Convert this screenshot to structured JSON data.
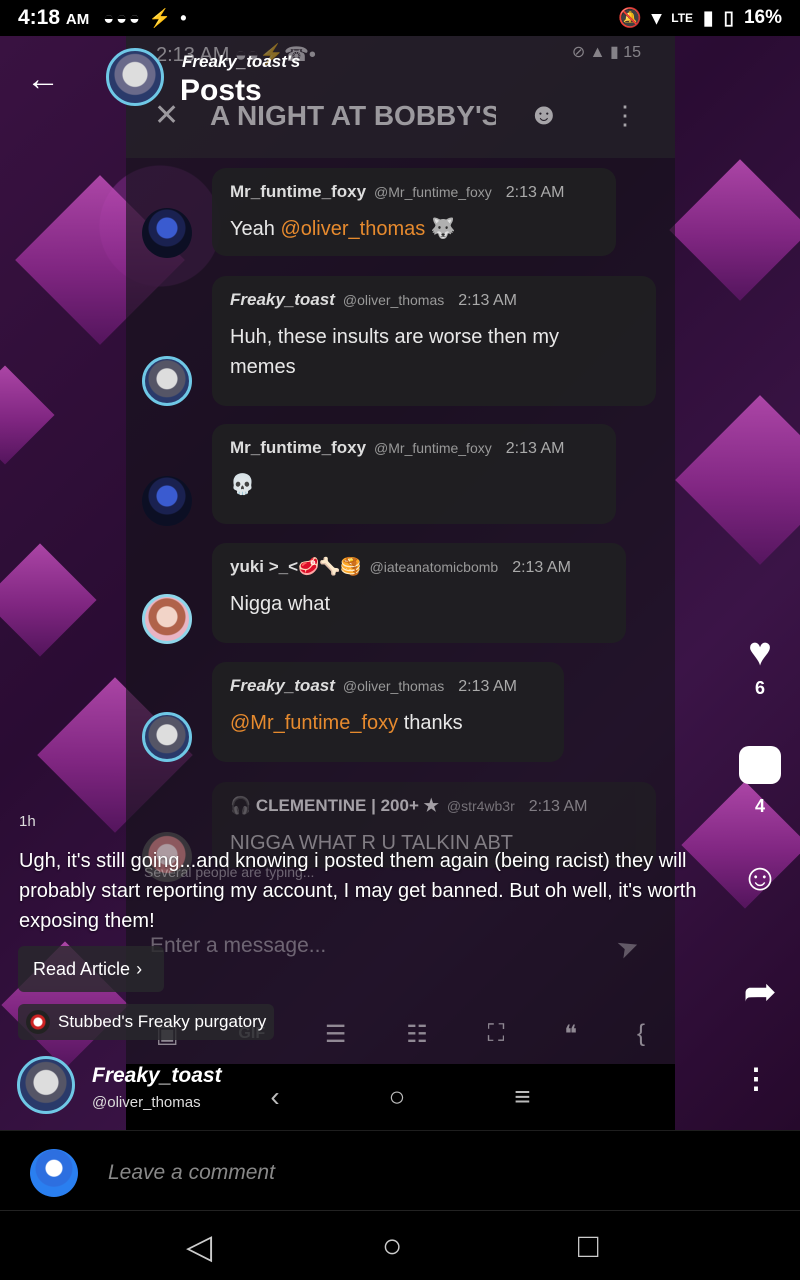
{
  "status_bar": {
    "time": "4:18",
    "ampm": "AM",
    "notification_icons": "◒◒◒ ⚡ •",
    "lte": "LTE",
    "battery": "16%"
  },
  "header": {
    "owner": "Freaky_toast's",
    "title": "Posts"
  },
  "shot": {
    "status_time": "2:13 AM ◒◒⚡☎•",
    "status_right": "⊘ ▲ ▮ 15",
    "title": "A NIGHT AT BOBBY'S"
  },
  "messages": [
    {
      "name": "Mr_funtime_foxy",
      "handle": "@Mr_funtime_foxy",
      "time": "2:13 AM",
      "text": "Yeah",
      "mention": "@oliver_thomas",
      "emoji": "🐺"
    },
    {
      "name": "Freaky_toast",
      "handle": "@oliver_thomas",
      "time": "2:13 AM",
      "text": "Huh, these insults are worse then my memes"
    },
    {
      "name": "Mr_funtime_foxy",
      "handle": "@Mr_funtime_foxy",
      "time": "2:13 AM",
      "text": "💀"
    },
    {
      "name": "yuki >_<🥩🦴🥞",
      "handle": "@iateanatomicbomb",
      "time": "2:13 AM",
      "text": "Nigga what"
    },
    {
      "name": "Freaky_toast",
      "handle": "@oliver_thomas",
      "time": "2:13 AM",
      "mention": "@Mr_funtime_foxy",
      "text": "thanks"
    },
    {
      "name": "🎧 CLEMENTINE | 200+ ★",
      "handle": "@str4wb3r",
      "time": "2:13 AM",
      "text": "NIGGA WHAT R U TALKIN ABT"
    }
  ],
  "shot_typing": "Several people are typing...",
  "shot_input_placeholder": "Enter a message...",
  "rail": {
    "likes": "6",
    "comments": "4"
  },
  "post": {
    "time_ago": "1h",
    "caption": "Ugh, it's still going...and knowing i posted them again (being racist) they will probably start reporting my account, I may get banned. But oh well, it's worth exposing them!",
    "read_article": "Read Article",
    "community": "Stubbed's Freaky purgatory",
    "author_name": "Freaky_toast",
    "author_handle": "@oliver_thomas"
  },
  "comment": {
    "placeholder": "Leave a comment"
  }
}
